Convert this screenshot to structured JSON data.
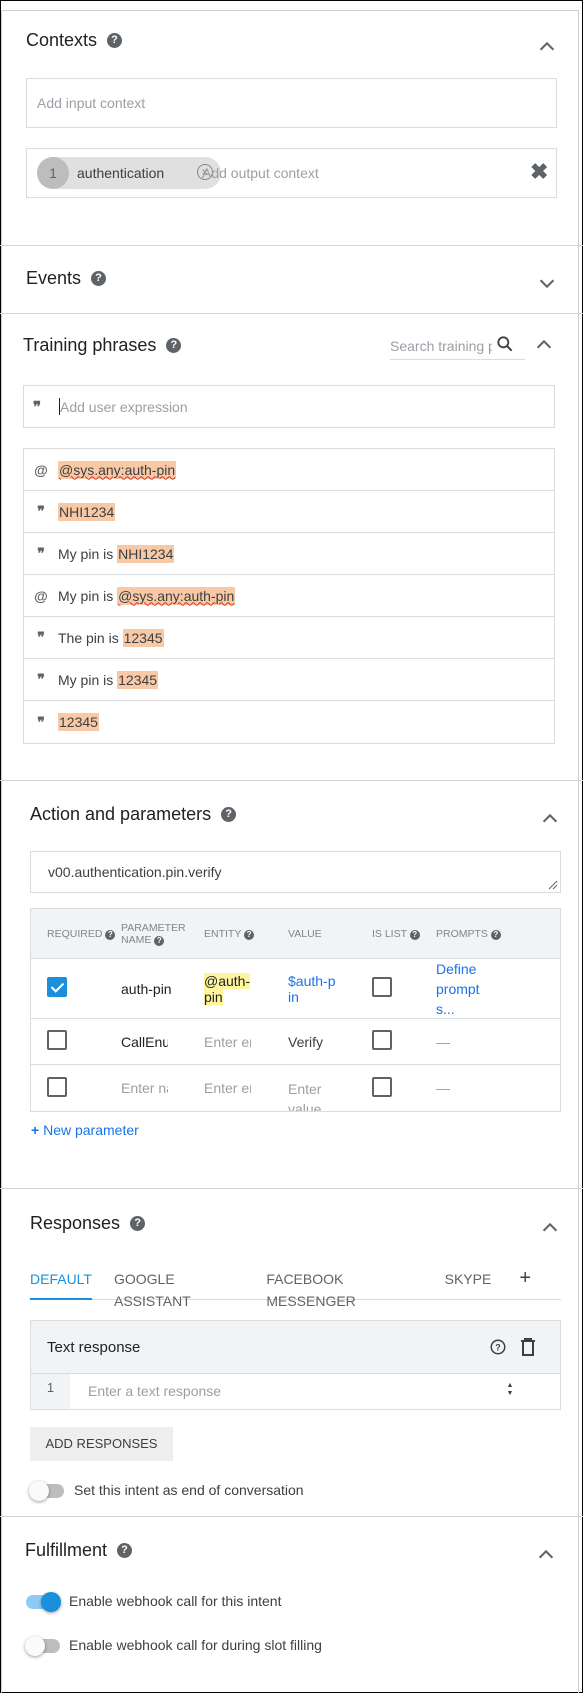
{
  "contexts": {
    "title": "Contexts",
    "input_placeholder": "Add input context",
    "output_chip_number": "1",
    "output_chip_label": "authentication",
    "output_placeholder": "Add output context"
  },
  "events": {
    "title": "Events"
  },
  "training": {
    "title": "Training phrases",
    "search_placeholder": "Search training p",
    "add_placeholder": "Add user expression",
    "rows": [
      {
        "icon": "@",
        "prefix": "",
        "highlight": "@sys.any:auth-pin"
      },
      {
        "icon": "❞",
        "prefix": "",
        "highlight": "NHI1234"
      },
      {
        "icon": "❞",
        "prefix": "My pin is ",
        "highlight": "NHI1234"
      },
      {
        "icon": "@",
        "prefix": "My pin is ",
        "highlight": "@sys.any:auth-pin"
      },
      {
        "icon": "❞",
        "prefix": "The pin is ",
        "highlight": "12345"
      },
      {
        "icon": "❞",
        "prefix": "My pin is ",
        "highlight": "12345"
      },
      {
        "icon": "❞",
        "prefix": "",
        "highlight": "12345"
      }
    ]
  },
  "action": {
    "title": "Action and parameters",
    "action_value": "v00.authentication.pin.verify",
    "headers": {
      "required": "REQUIRED",
      "param_name_1": "PARAMETER",
      "param_name_2": "NAME",
      "entity": "ENTITY",
      "value": "VALUE",
      "is_list": "IS LIST",
      "prompts": "PROMPTS"
    },
    "rows": [
      {
        "name": "auth-pin",
        "entity_1": "@auth-",
        "entity_2": "pin",
        "value_1": "$auth-p",
        "value_2": "in",
        "prompts_1": "Define",
        "prompts_2": "prompt",
        "prompts_3": "s..."
      },
      {
        "name": "CallEnum",
        "entity": "Enter entity",
        "value": "Verify",
        "prompts": "—"
      },
      {
        "name": "Enter name",
        "entity": "Enter entity",
        "value_1": "Enter",
        "value_2": "value",
        "prompts": "—"
      }
    ],
    "new_parameter": "New parameter"
  },
  "responses": {
    "title": "Responses",
    "tabs": [
      "DEFAULT",
      "GOOGLE ASSISTANT",
      "FACEBOOK MESSENGER",
      "SKYPE"
    ],
    "add_tab": "+",
    "card_title": "Text response",
    "line_number": "1",
    "text_placeholder": "Enter a text response",
    "add_button": "ADD RESPONSES",
    "end_conversation_label": "Set this intent as end of conversation"
  },
  "fulfillment": {
    "title": "Fulfillment",
    "webhook_label": "Enable webhook call for this intent",
    "slot_label": "Enable webhook call for during slot filling",
    "webhook_enabled": true,
    "slot_enabled": false
  },
  "colors": {
    "accent": "#1a8fdc",
    "highlight": "#f9c9a5",
    "entity_highlight": "#fff59d"
  }
}
